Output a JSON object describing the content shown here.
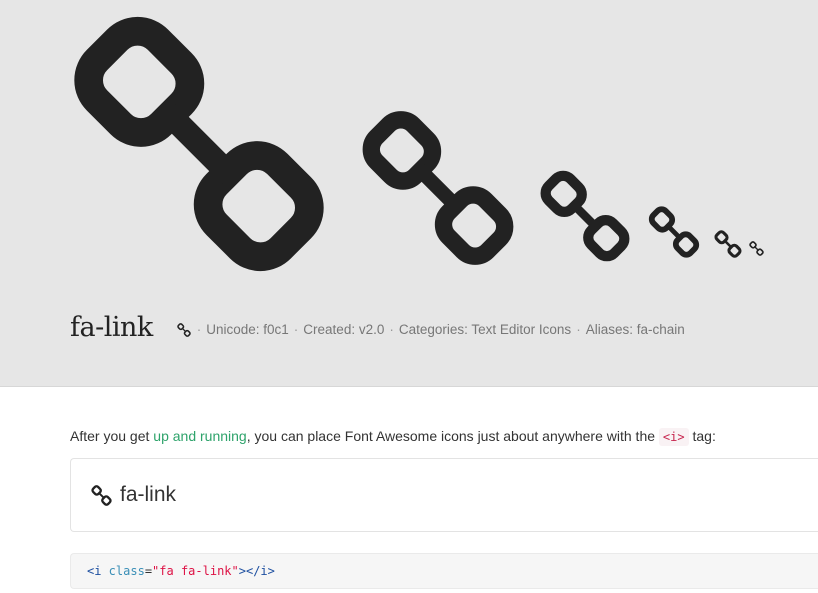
{
  "icon": {
    "name": "fa-link",
    "meta": {
      "unicode": "Unicode: f0c1",
      "created": "Created: v2.0",
      "categories": "Categories: Text Editor Icons",
      "aliases": "Aliases: fa-chain",
      "separator": "·"
    }
  },
  "intro": {
    "before": "After you get ",
    "link": "up and running",
    "after": ", you can place Font Awesome icons just about anywhere with the ",
    "code": "<i>",
    "end": " tag:"
  },
  "example": {
    "label": "fa-link"
  },
  "code": {
    "open_tag": "<i",
    "attr": " class",
    "eq": "=",
    "value": "\"fa fa-link\"",
    "close": "></i>"
  },
  "colors": {
    "header_bg": "#e6e6e6",
    "icon": "#222222",
    "link": "#2ea36b",
    "code_red": "#c7254e"
  },
  "icons": [
    "link-icon"
  ]
}
